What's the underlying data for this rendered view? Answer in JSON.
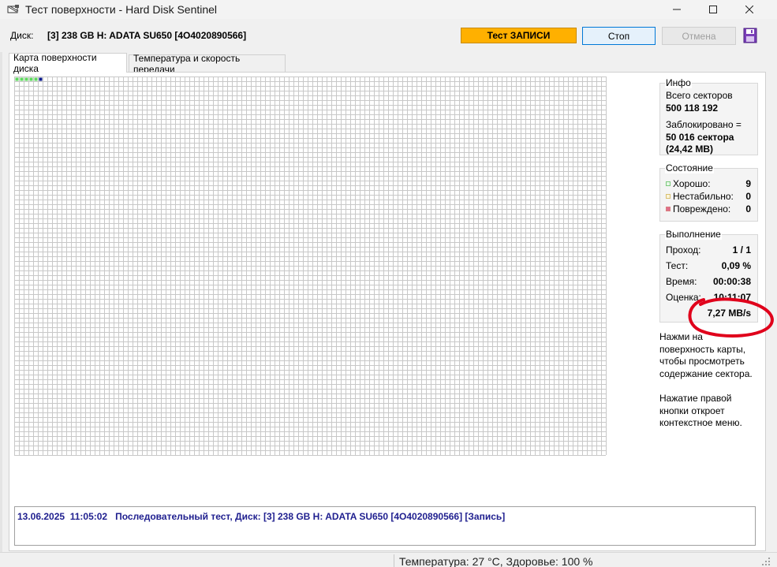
{
  "window": {
    "title": "Тест поверхности - Hard Disk Sentinel",
    "icon": "disk-surface-icon"
  },
  "toolbar": {
    "disk_label": "Диск:",
    "disk_value": "[3] 238 GB H: ADATA SU650 [4O4020890566]",
    "status": "Тест ЗАПИСИ",
    "stop": "Стоп",
    "cancel": "Отмена",
    "status_color": "#ffb000"
  },
  "tabs": [
    {
      "label": "Карта поверхности диска",
      "active": true
    },
    {
      "label": "Температура и скорость передачи",
      "active": false
    }
  ],
  "surface_map": {
    "blocks_good": 5,
    "blocks_current": 1,
    "colors": {
      "good": "#5ed85e",
      "current": "#0a1a8c",
      "empty": "#ffffff",
      "grid": "#c8c8c8"
    }
  },
  "info": {
    "title": "Инфо",
    "total_sectors_label": "Всего секторов",
    "total_sectors": "500 118 192",
    "locked_label": "Заблокировано =",
    "locked_sectors": "50 016 сектора",
    "locked_size": "(24,42 MB)"
  },
  "state": {
    "title": "Состояние",
    "items": [
      {
        "label": "Хорошо:",
        "value": "9",
        "color": "#7cc97c"
      },
      {
        "label": "Нестабильно:",
        "value": "0",
        "color": "#d8c070"
      },
      {
        "label": "Повреждено:",
        "value": "0",
        "color": "#d98080"
      }
    ]
  },
  "progress": {
    "title": "Выполнение",
    "pass_label": "Проход:",
    "pass_value": "1 / 1",
    "test_label": "Тест:",
    "test_value": "0,09 %",
    "time_label": "Время:",
    "time_value": "00:00:38",
    "estimate_label": "Оценка:",
    "estimate_value": "10:11:07",
    "speed": "7,27 MB/s"
  },
  "help": {
    "click_lines": [
      "Нажми на",
      "поверхность карты,",
      "чтобы просмотреть",
      "содержание сектора."
    ],
    "right_click_lines": [
      "Нажатие правой",
      "кнопки откроет",
      "контекстное меню."
    ]
  },
  "log": {
    "date": "13.06.2025",
    "time": "11:05:02",
    "message": "Последовательный тест, Диск: [3] 238 GB H: ADATA SU650 [4O4020890566] [Запись]"
  },
  "statusbar": {
    "text": "Температура: 27  °C,  Здоровье: 100 %"
  },
  "annotation": {
    "color": "#e0001b"
  }
}
